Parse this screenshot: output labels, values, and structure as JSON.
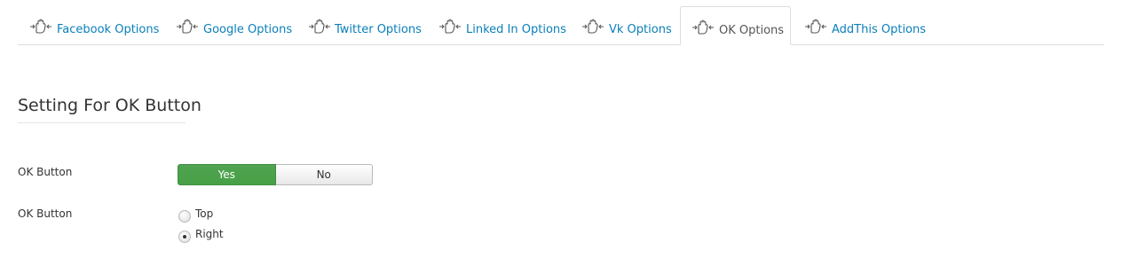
{
  "tabs": [
    {
      "label": "Facebook Options",
      "icon": "hand-pointer-icon",
      "active": false
    },
    {
      "label": "Google Options",
      "icon": "hand-pointer-icon",
      "active": false
    },
    {
      "label": "Twitter Options",
      "icon": "hand-pointer-icon",
      "active": false
    },
    {
      "label": "Linked In Options",
      "icon": "hand-pointer-icon",
      "active": false
    },
    {
      "label": "Vk Options",
      "icon": "hand-pointer-icon",
      "active": false
    },
    {
      "label": "OK Options",
      "icon": "hand-pointer-icon",
      "active": true
    },
    {
      "label": "AddThis Options",
      "icon": "hand-pointer-icon",
      "active": false
    }
  ],
  "colors": {
    "link": "#0a7fba",
    "active_tab_text": "#555555",
    "yes_green": "#4ca14b"
  },
  "section": {
    "title": "Setting For OK Button"
  },
  "fields": {
    "enable": {
      "label": "OK Button",
      "yes_label": "Yes",
      "no_label": "No",
      "selected": "Yes"
    },
    "position": {
      "label": "OK Button",
      "options": [
        "Top",
        "Right"
      ],
      "selected": "Right"
    }
  }
}
